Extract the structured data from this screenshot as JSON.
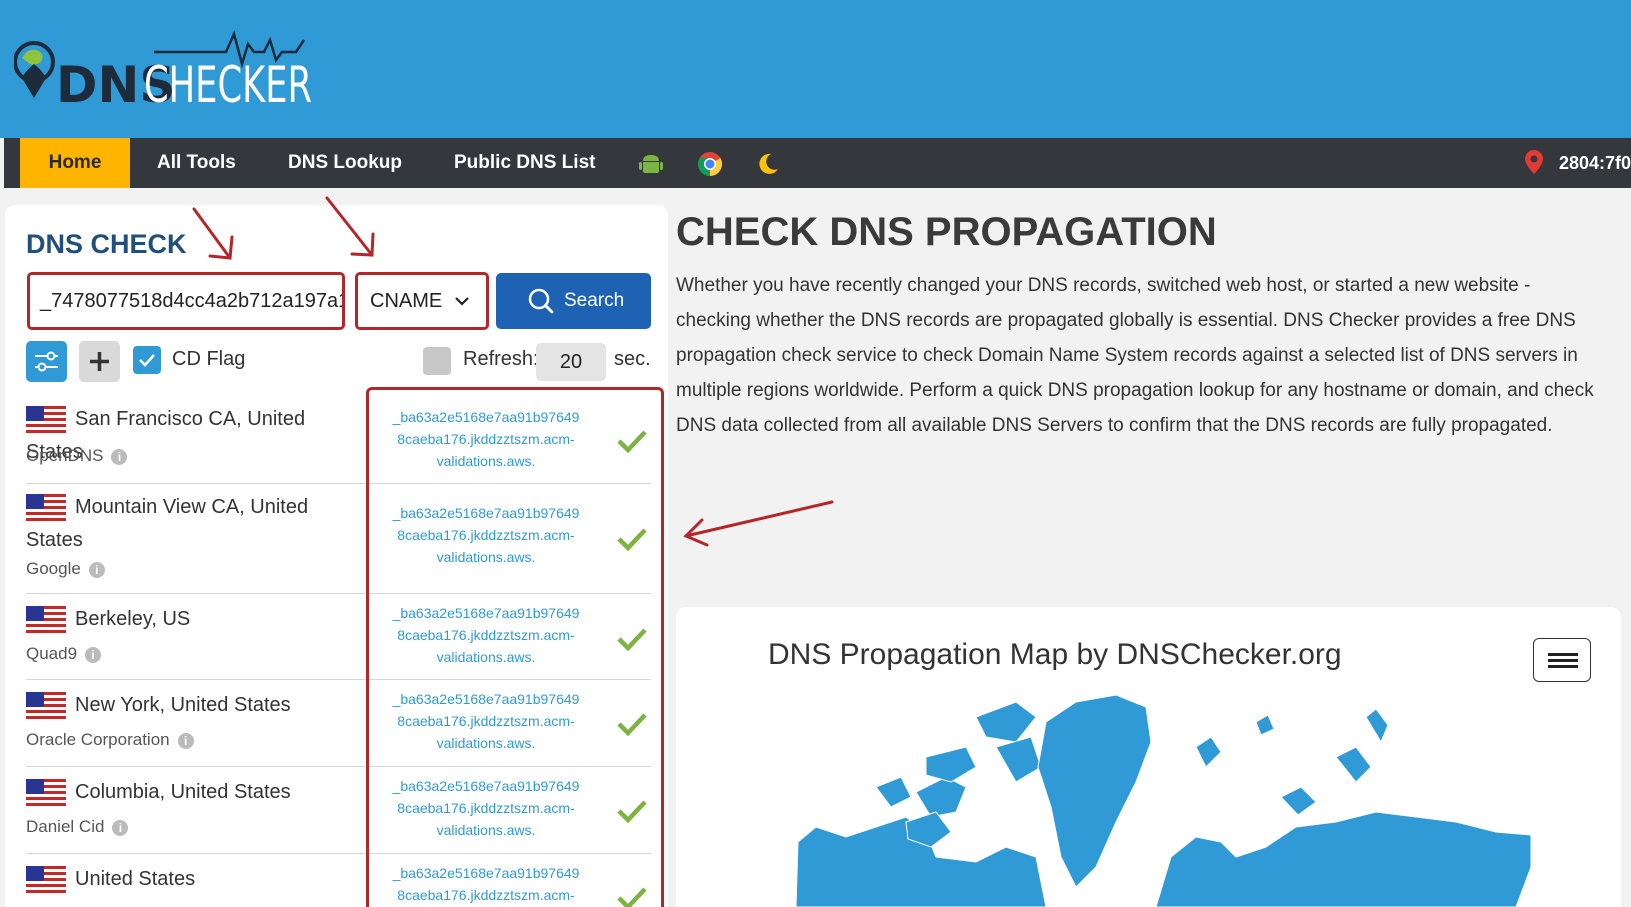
{
  "brand": {
    "logo_primary": "DNS",
    "logo_secondary": "CHECKER",
    "color": "#2f9ad6"
  },
  "nav": {
    "items": [
      "Home",
      "All Tools",
      "DNS Lookup",
      "Public DNS List"
    ],
    "icons": [
      "android-icon",
      "chrome-icon",
      "moon-icon"
    ],
    "ip": "2804:7f0"
  },
  "dns_check": {
    "title": "DNS CHECK",
    "hostname_value": "_7478077518d4cc4a2b712a197a1",
    "record_type": "CNAME",
    "search_label": "Search",
    "cd_flag_label": "CD Flag",
    "cd_flag_checked": true,
    "refresh_label": "Refresh:",
    "refresh_value": "20",
    "refresh_unit": "sec."
  },
  "results": [
    {
      "location": "San Francisco CA, United States",
      "provider": "OpenDNS",
      "value": "_ba63a2e5168e7aa91b97649 8caeba176.jkddzztszm.acm-validations.aws.",
      "line1": "_ba63a2e5168e7aa91b97649",
      "line2": "8caeba176.jkddzztszm.acm-",
      "line3": "validations.aws.",
      "status": "ok"
    },
    {
      "location": "Mountain View CA, United States",
      "provider": "Google",
      "line1": "_ba63a2e5168e7aa91b97649",
      "line2": "8caeba176.jkddzztszm.acm-",
      "line3": "validations.aws.",
      "status": "ok"
    },
    {
      "location": "Berkeley, US",
      "provider": "Quad9",
      "line1": "_ba63a2e5168e7aa91b97649",
      "line2": "8caeba176.jkddzztszm.acm-",
      "line3": "validations.aws.",
      "status": "ok"
    },
    {
      "location": "New York, United States",
      "provider": "Oracle Corporation",
      "line1": "_ba63a2e5168e7aa91b97649",
      "line2": "8caeba176.jkddzztszm.acm-",
      "line3": "validations.aws.",
      "status": "ok"
    },
    {
      "location": "Columbia, United States",
      "provider": "Daniel Cid",
      "line1": "_ba63a2e5168e7aa91b97649",
      "line2": "8caeba176.jkddzztszm.acm-",
      "line3": "validations.aws.",
      "status": "ok"
    },
    {
      "location": "United States",
      "provider": "",
      "line1": "_ba63a2e5168e7aa91b97649",
      "line2": "8caeba176.jkddzztszm.acm-",
      "line3": "",
      "status": "ok"
    }
  ],
  "main": {
    "title": "CHECK DNS PROPAGATION",
    "description": "Whether you have recently changed your DNS records, switched web host, or started a new website - checking whether the DNS records are propagated globally is essential. DNS Checker provides a free DNS propagation check service to check Domain Name System records against a selected list of DNS servers in multiple regions worldwide. Perform a quick DNS propagation lookup for any hostname or domain, and check DNS data collected from all available DNS Servers to confirm that the DNS records are fully propagated."
  },
  "map": {
    "title": "DNS Propagation Map by DNSChecker.org"
  }
}
